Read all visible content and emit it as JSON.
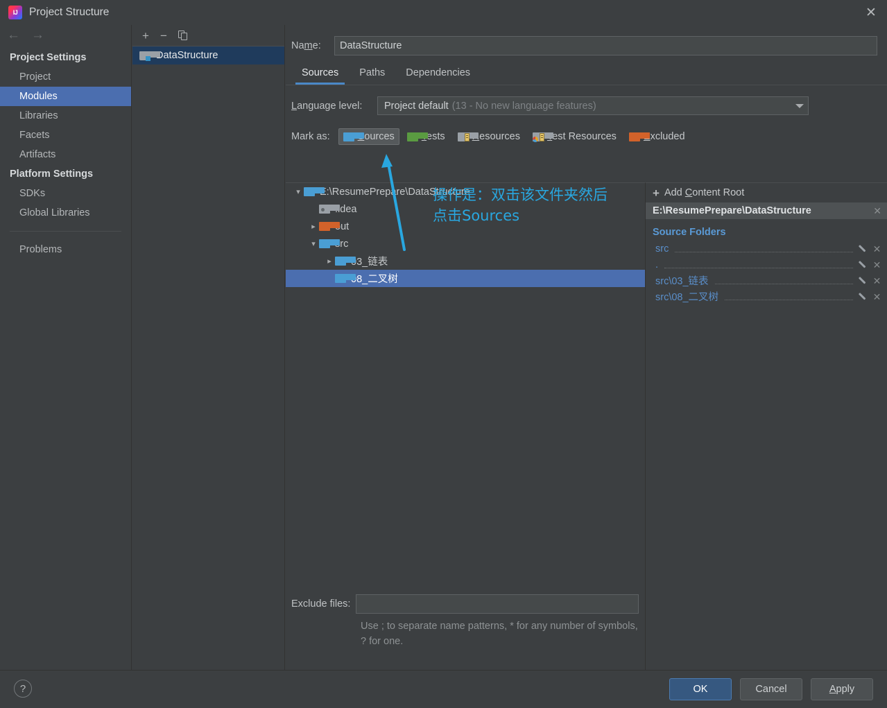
{
  "window": {
    "title": "Project Structure",
    "app_icon": "intellij-idea-icon",
    "close_label": "✕"
  },
  "nav": {
    "back_icon": "←",
    "forward_icon": "→"
  },
  "sidebar": {
    "groups": [
      {
        "label": "Project Settings",
        "items": [
          {
            "label": "Project",
            "selected": false
          },
          {
            "label": "Modules",
            "selected": true
          },
          {
            "label": "Libraries",
            "selected": false
          },
          {
            "label": "Facets",
            "selected": false
          },
          {
            "label": "Artifacts",
            "selected": false
          }
        ]
      },
      {
        "label": "Platform Settings",
        "items": [
          {
            "label": "SDKs",
            "selected": false
          },
          {
            "label": "Global Libraries",
            "selected": false
          }
        ]
      }
    ],
    "problems": "Problems"
  },
  "module_panel": {
    "toolbar": {
      "add_label": "+",
      "remove_label": "−",
      "copy_label": "copy-icon"
    },
    "modules": [
      {
        "name": "DataStructure",
        "selected": true
      }
    ]
  },
  "main": {
    "name_field": {
      "label_pre": "Na",
      "label_mnemonic": "m",
      "label_post": "e:",
      "value": "DataStructure"
    },
    "tabs": [
      {
        "label": "Sources",
        "active": true
      },
      {
        "label": "Paths",
        "active": false
      },
      {
        "label": "Dependencies",
        "active": false
      }
    ],
    "language_level": {
      "label_mnemonic": "L",
      "label_rest": "anguage level:",
      "value": "Project default",
      "detail": "(13 - No new language features)"
    },
    "mark_as": {
      "label": "Mark as:",
      "buttons": [
        {
          "pre": "",
          "mnemonic": "S",
          "post": "ources",
          "icon": "folder-sources-icon",
          "pressed": true
        },
        {
          "pre": "",
          "mnemonic": "T",
          "post": "ests",
          "icon": "folder-tests-icon",
          "pressed": false
        },
        {
          "pre": "",
          "mnemonic": "R",
          "post": "esources",
          "icon": "folder-resources-icon",
          "pressed": false
        },
        {
          "pre": "",
          "mnemonic": "T",
          "post": "est Resources",
          "icon": "folder-test-resources-icon",
          "pressed": false
        },
        {
          "pre": "",
          "mnemonic": "E",
          "post": "xcluded",
          "icon": "folder-excluded-icon",
          "pressed": false
        }
      ]
    },
    "tree": [
      {
        "label": "E:\\ResumePrepare\\DataStructure",
        "depth": 0,
        "chevron": "expanded",
        "icon": "folder-blue-icon",
        "selected": false
      },
      {
        "label": ".idea",
        "depth": 1,
        "chevron": "none",
        "icon": "folder-idea-icon",
        "selected": false
      },
      {
        "label": "out",
        "depth": 1,
        "chevron": "collapsed",
        "icon": "folder-orange-icon",
        "selected": false
      },
      {
        "label": "src",
        "depth": 1,
        "chevron": "expanded",
        "icon": "folder-blue-icon",
        "selected": false
      },
      {
        "label": "03_链表",
        "depth": 2,
        "chevron": "collapsed",
        "icon": "folder-blue-icon",
        "selected": false
      },
      {
        "label": "08_二叉树",
        "depth": 2,
        "chevron": "none",
        "icon": "folder-blue-icon",
        "selected": true
      }
    ],
    "exclude_files": {
      "label": "Exclude files:",
      "value": "",
      "hint": "Use ; to separate name patterns, * for any number of symbols, ? for one."
    }
  },
  "right_panel": {
    "add_content_root": {
      "plus": "+",
      "pre": "Add ",
      "mnemonic": "C",
      "post": "ontent Root"
    },
    "content_root": {
      "path": "E:\\ResumePrepare\\DataStructure",
      "close": "✕"
    },
    "source_folders_title": "Source Folders",
    "source_folders": [
      {
        "path": "src"
      },
      {
        "path": "."
      },
      {
        "path": "src\\03_链表"
      },
      {
        "path": "src\\08_二叉树"
      }
    ]
  },
  "annotation": {
    "line1": "操作是：双击该文件夹然后",
    "line2": "点击Sources",
    "color": "#29a7e0"
  },
  "footer": {
    "help": "?",
    "ok": "OK",
    "cancel": "Cancel",
    "apply_mnemonic": "A",
    "apply_rest": "pply"
  },
  "colors": {
    "background": "#3c3f41",
    "selection_blue": "#4b6eaf",
    "selection_inactive": "#1f3b5c",
    "accent_link": "#5a9ad6",
    "tab_underline": "#4a88c7",
    "primary_button": "#365880"
  }
}
